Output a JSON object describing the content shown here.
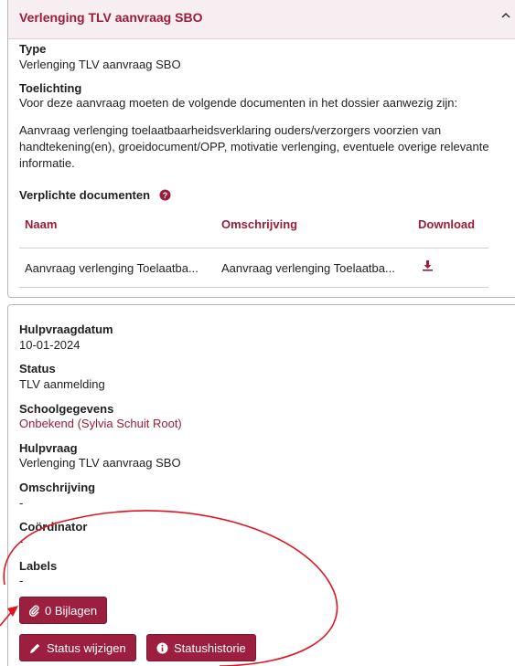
{
  "card1": {
    "title": "Verlenging TLV aanvraag SBO",
    "type_label": "Type",
    "type_value": "Verlenging TLV aanvraag SBO",
    "toelichting_label": "Toelichting",
    "toelichting_line1": "Voor deze aanvraag moeten de volgende documenten in het dossier aanwezig zijn:",
    "toelichting_para": "Aanvraag verlenging toelaatbaarheidsverklaring ouders/verzorgers voorzien van handtekening(en), groeidocument/OPP, motivatie verlenging, eventuele overige relevante informatie.",
    "documents_label": "Verplichte documenten",
    "table": {
      "headers": [
        "Naam",
        "Omschrijving",
        "Download"
      ],
      "rows": [
        {
          "naam": "Aanvraag verlenging Toelaatba...",
          "omschrijving": "Aanvraag verlenging Toelaatba..."
        }
      ]
    }
  },
  "card2": {
    "fields": [
      {
        "label": "Hulpvraagdatum",
        "value": "10-01-2024"
      },
      {
        "label": "Status",
        "value": "TLV aanmelding"
      },
      {
        "label": "Schoolgegevens",
        "value": "Onbekend (Sylvia Schuit Root)"
      },
      {
        "label": "Hulpvraag",
        "value": "Verlenging TLV aanvraag SBO"
      },
      {
        "label": "Omschrijving",
        "value": "-"
      },
      {
        "label": "Coördinator",
        "value": "-"
      },
      {
        "label": "Labels",
        "value": "-"
      }
    ],
    "buttons": {
      "attachments": "0 Bijlagen",
      "change_status": "Status wijzigen",
      "status_history": "Statushistorie"
    }
  },
  "colors": {
    "accent": "#9a1d3a",
    "button": "#9d1f3f",
    "annotation": "#e0141e"
  },
  "icons": [
    "chevron-up-icon",
    "question-circle-icon",
    "download-icon",
    "paperclip-icon",
    "pencil-icon",
    "info-circle-icon"
  ]
}
